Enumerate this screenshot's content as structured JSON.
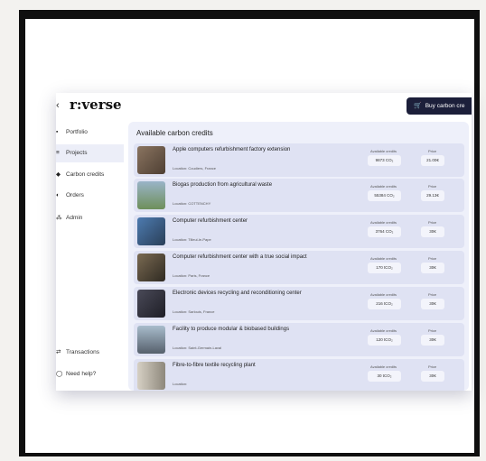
{
  "app": {
    "logo": "r:verse",
    "buy_button": "Buy carbon cre"
  },
  "sidebar": {
    "items": [
      {
        "label": "Portfolio",
        "icon": "briefcase-icon"
      },
      {
        "label": "Projects",
        "icon": "list-icon"
      },
      {
        "label": "Carbon credits",
        "icon": "leaf-icon"
      },
      {
        "label": "Orders",
        "icon": "cart-icon"
      },
      {
        "label": "Admin",
        "icon": "user-icon"
      }
    ],
    "bottom": [
      {
        "label": "Transactions",
        "icon": "arrows-icon"
      },
      {
        "label": "Need help?",
        "icon": "help-icon"
      }
    ]
  },
  "main": {
    "title": "Available carbon credits",
    "credits_label": "Available credits",
    "price_label": "Price",
    "cards": [
      {
        "title": "Apple computers refurbishment factory extension",
        "location": "Location: Coudiers, France",
        "credits": "9873 CO₂",
        "price": "21.00€",
        "thumb": "#6b5a4a"
      },
      {
        "title": "Biogas production from agricultural waste",
        "location": "Location: COTTENCHY",
        "credits": "55384 CO₂",
        "price": "29.13€",
        "thumb": "#6e8f5a"
      },
      {
        "title": "Computer refurbishment center",
        "location": "Location: Tilleul-le-Pape",
        "credits": "3764 CO₂",
        "price": "30€",
        "thumb": "#3b5f8a"
      },
      {
        "title": "Computer refurbishment center with a true social impact",
        "location": "Location: Paris, France",
        "credits": "170 tCO₂",
        "price": "30€",
        "thumb": "#5a5040"
      },
      {
        "title": "Electronic devices recycling and reconditioning center",
        "location": "Location: Sarlouis, France",
        "credits": "216 tCO₂",
        "price": "30€",
        "thumb": "#3a3a46"
      },
      {
        "title": "Facility to produce modular & biobased buildings",
        "location": "Location: Saint-Germain-Laval",
        "credits": "120 tCO₂",
        "price": "30€",
        "thumb": "#7a8898"
      },
      {
        "title": "Fibre-to-fibre textile recycling plant",
        "location": "Location:",
        "credits": "30 tCO₂",
        "price": "30€",
        "thumb": "#b8b2a6"
      }
    ]
  }
}
